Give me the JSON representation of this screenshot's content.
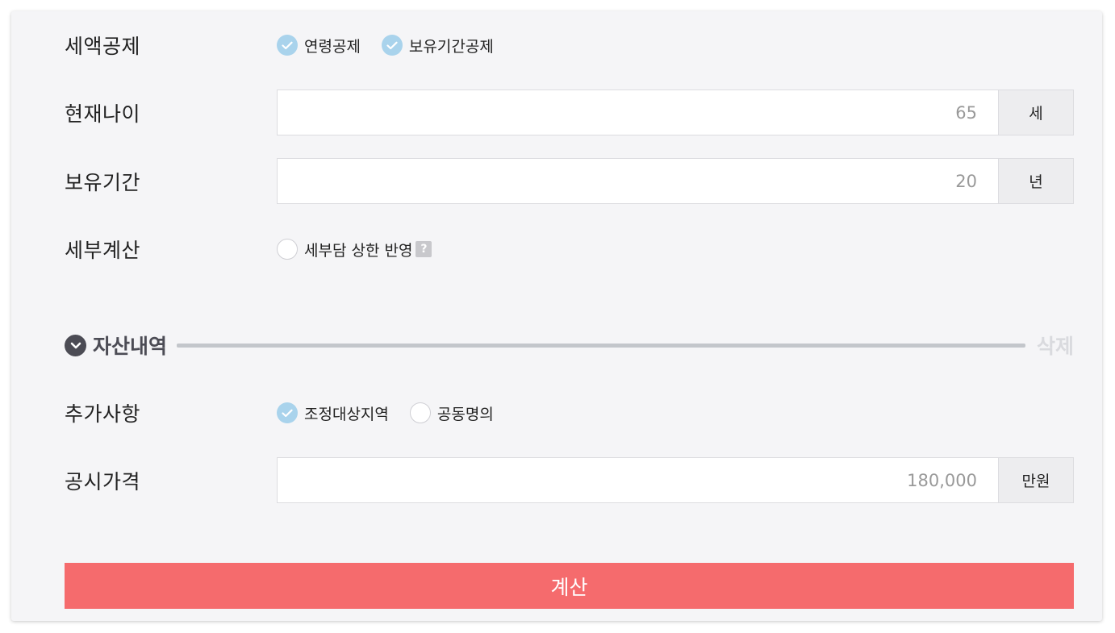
{
  "tax_credit": {
    "label": "세액공제",
    "options": [
      {
        "label": "연령공제",
        "checked": true
      },
      {
        "label": "보유기간공제",
        "checked": true
      }
    ]
  },
  "age": {
    "label": "현재나이",
    "value": "65",
    "unit": "세"
  },
  "holding_period": {
    "label": "보유기간",
    "value": "20",
    "unit": "년"
  },
  "detail_calc": {
    "label": "세부계산",
    "option_label": "세부담 상한 반영",
    "checked": false,
    "help_glyph": "?"
  },
  "asset_section": {
    "title": "자산내역",
    "delete_label": "삭제",
    "icon": "chevron-down-icon"
  },
  "extra": {
    "label": "추가사항",
    "options": [
      {
        "label": "조정대상지역",
        "checked": true
      },
      {
        "label": "공동명의",
        "checked": false
      }
    ]
  },
  "official_price": {
    "label": "공시가격",
    "value": "180,000",
    "unit": "만원"
  },
  "calculate_label": "계산",
  "colors": {
    "check_on": "#a9d3ec",
    "button": "#f56b6d",
    "section_line": "#c3c6cb",
    "card_bg": "#f5f5f7"
  }
}
